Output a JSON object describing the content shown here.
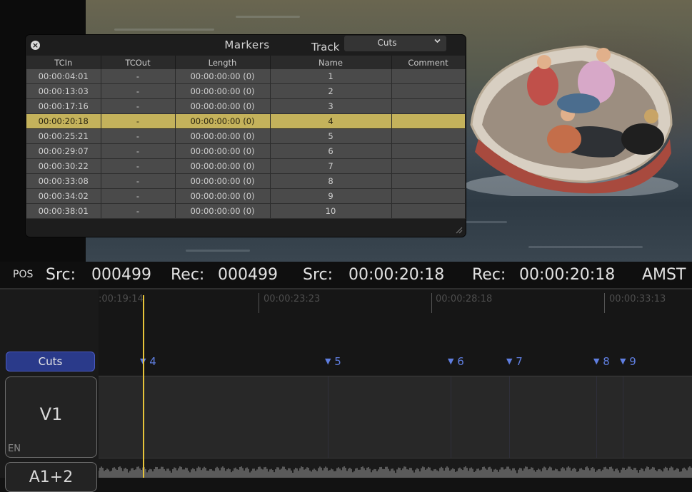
{
  "markers_panel": {
    "title": "Markers",
    "track_label": "Track",
    "track_value": "Cuts",
    "columns": [
      "TCIn",
      "TCOut",
      "Length",
      "Name",
      "Comment"
    ],
    "rows": [
      {
        "tcin": "00:00:04:01",
        "tcout": "-",
        "length": "00:00:00:00 (0)",
        "name": "1",
        "comment": ""
      },
      {
        "tcin": "00:00:13:03",
        "tcout": "-",
        "length": "00:00:00:00 (0)",
        "name": "2",
        "comment": ""
      },
      {
        "tcin": "00:00:17:16",
        "tcout": "-",
        "length": "00:00:00:00 (0)",
        "name": "3",
        "comment": ""
      },
      {
        "tcin": "00:00:20:18",
        "tcout": "-",
        "length": "00:00:00:00 (0)",
        "name": "4",
        "comment": ""
      },
      {
        "tcin": "00:00:25:21",
        "tcout": "-",
        "length": "00:00:00:00 (0)",
        "name": "5",
        "comment": ""
      },
      {
        "tcin": "00:00:29:07",
        "tcout": "-",
        "length": "00:00:00:00 (0)",
        "name": "6",
        "comment": ""
      },
      {
        "tcin": "00:00:30:22",
        "tcout": "-",
        "length": "00:00:00:00 (0)",
        "name": "7",
        "comment": ""
      },
      {
        "tcin": "00:00:33:08",
        "tcout": "-",
        "length": "00:00:00:00 (0)",
        "name": "8",
        "comment": ""
      },
      {
        "tcin": "00:00:34:02",
        "tcout": "-",
        "length": "00:00:00:00 (0)",
        "name": "9",
        "comment": ""
      },
      {
        "tcin": "00:00:38:01",
        "tcout": "-",
        "length": "00:00:00:00 (0)",
        "name": "10",
        "comment": ""
      }
    ],
    "selected_row": 3
  },
  "status_bar": {
    "pos_label": "POS",
    "src_label_1": "Src:",
    "src_frames": "000499",
    "rec_label_1": "Rec:",
    "rec_frames": "000499",
    "src_label_2": "Src:",
    "src_tc": "00:00:20:18",
    "rec_label_2": "Rec:",
    "rec_tc": "00:00:20:18",
    "overflow_text": "AMST"
  },
  "timeline": {
    "ruler_labels": [
      ":00:19:14",
      "00:00:23:23",
      "00:00:28:18",
      "00:00:33:13"
    ],
    "marker_track_name": "Cuts",
    "visible_markers": [
      "4",
      "5",
      "6",
      "7",
      "8",
      "9"
    ],
    "video_track": {
      "name": "V1",
      "language": "EN"
    },
    "audio_track": {
      "name": "A1+2"
    }
  },
  "colors": {
    "selected_row": "#c4b25b",
    "marker_blue": "#5f7ee0",
    "playhead": "#e7c43a",
    "cuts_button": "#2a3a8a"
  }
}
